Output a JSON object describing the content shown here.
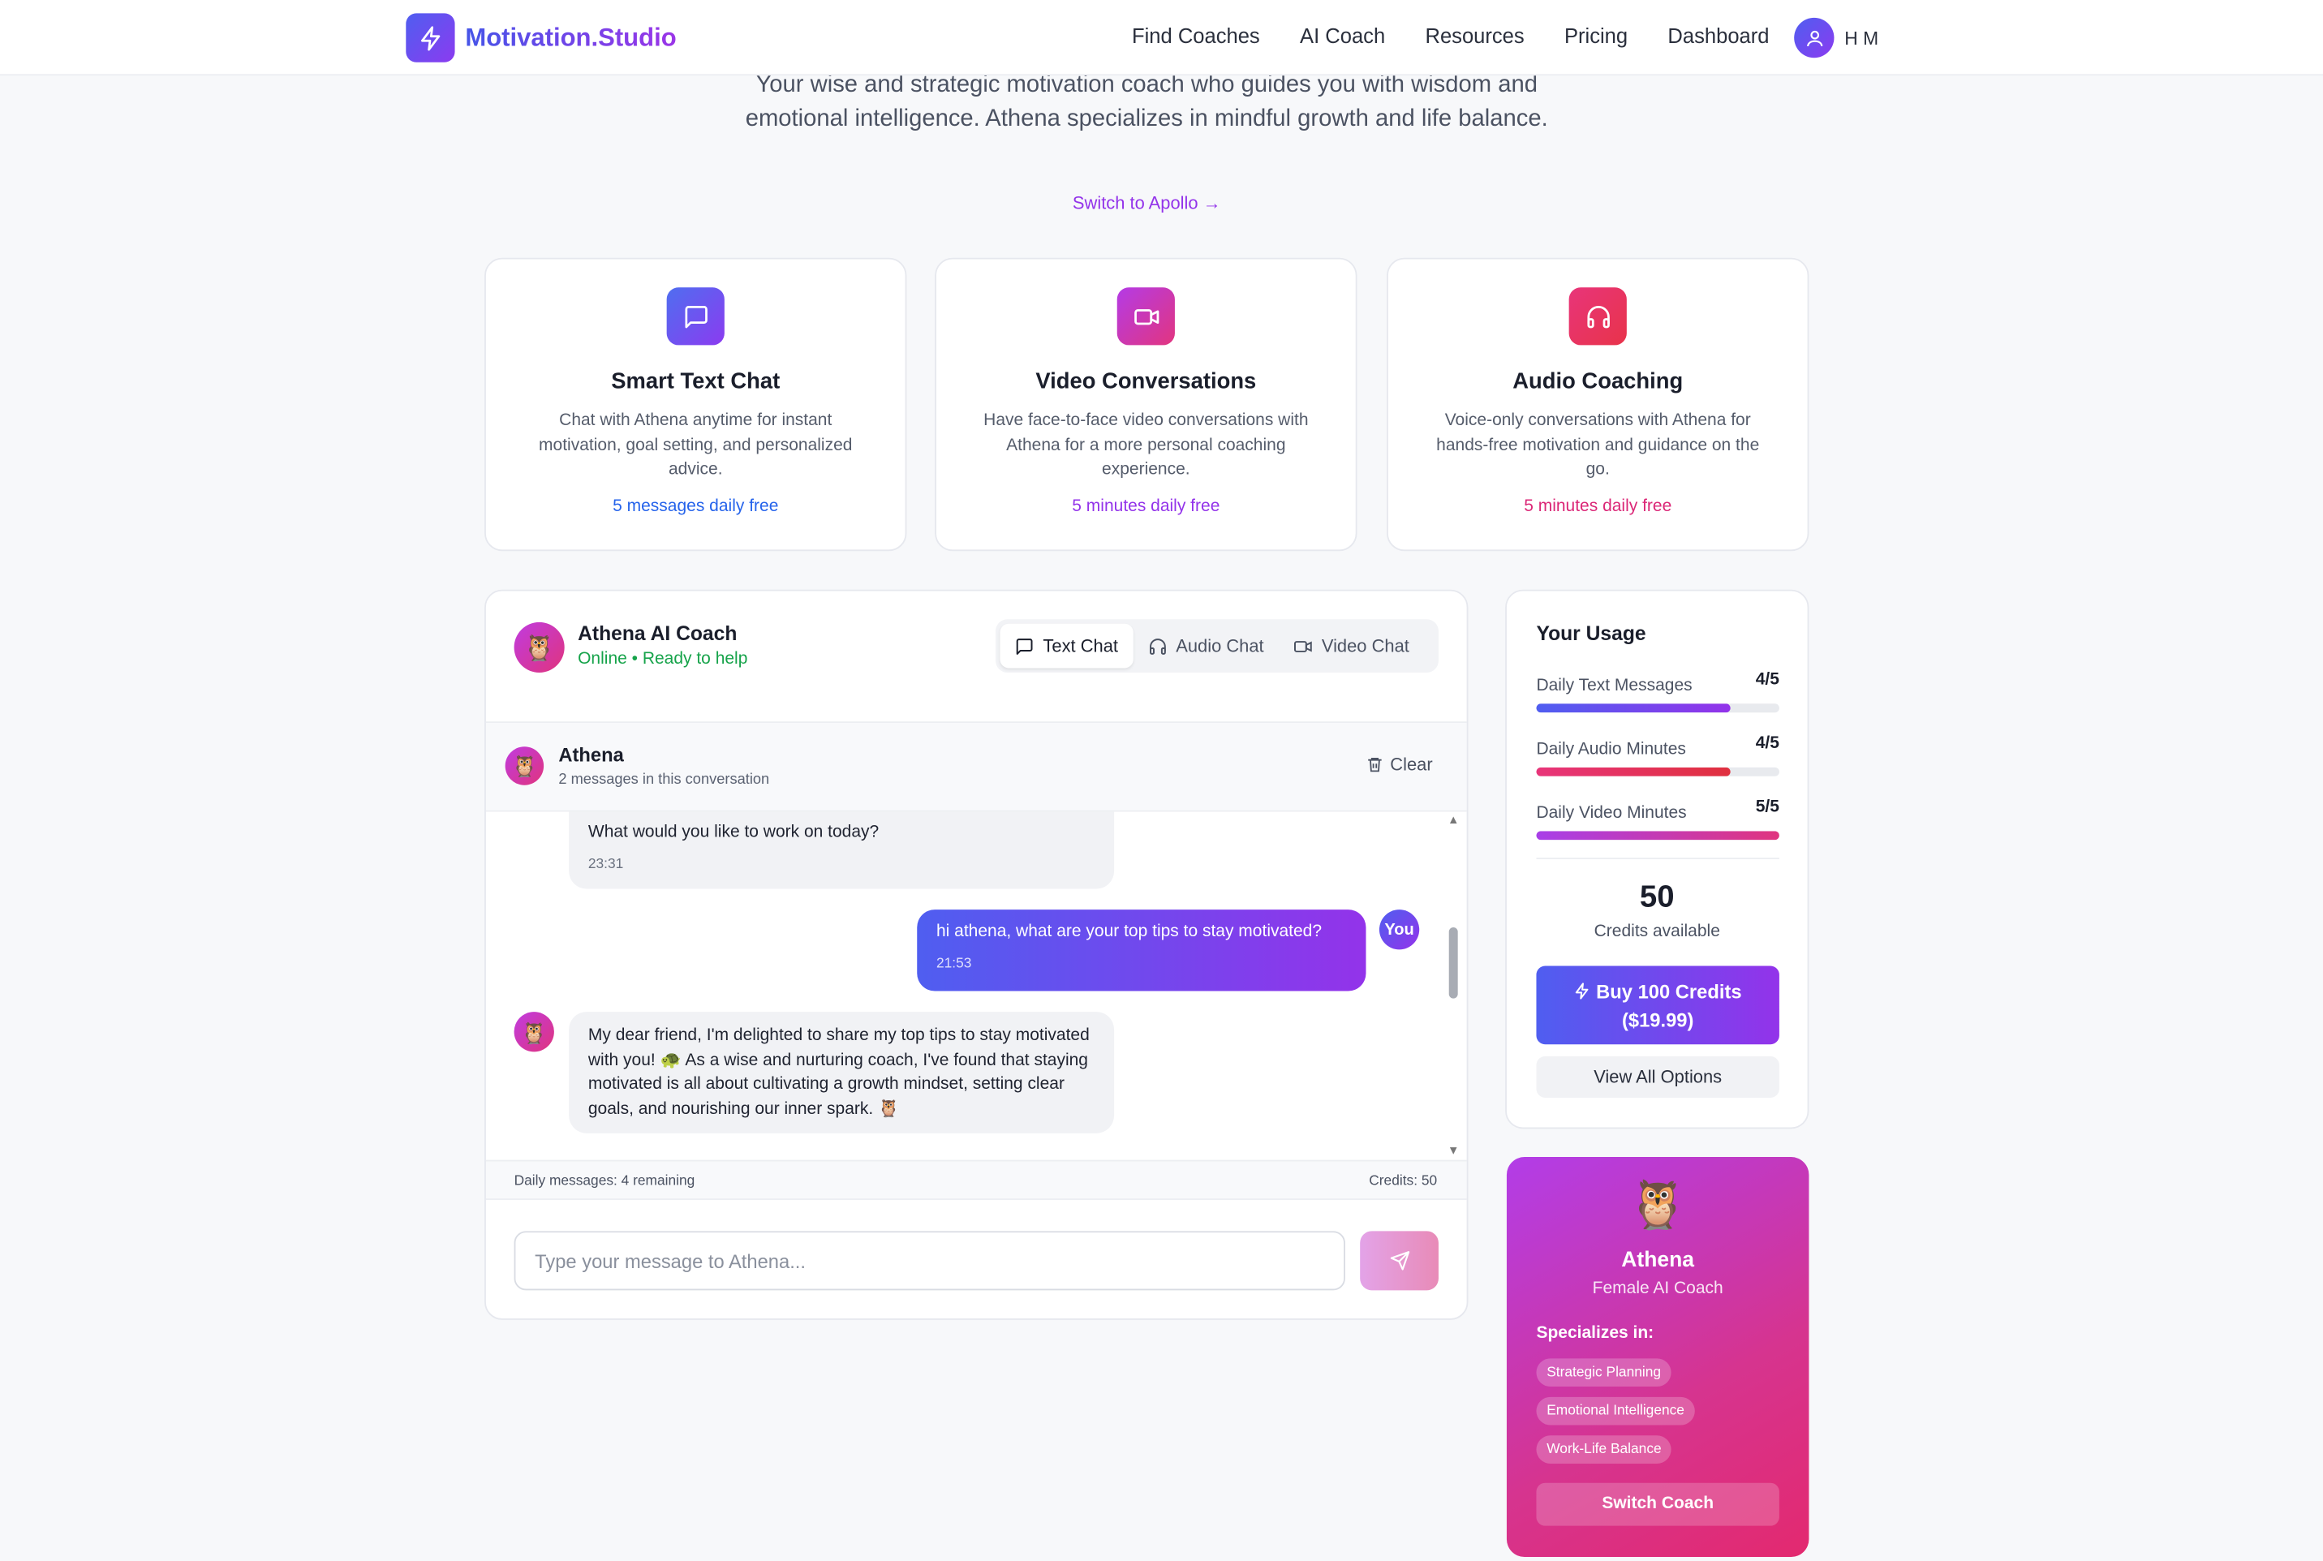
{
  "nav": {
    "brand": "Motivation.Studio",
    "links": [
      "Find Coaches",
      "AI Coach",
      "Resources",
      "Pricing",
      "Dashboard"
    ],
    "user_initials": "H M"
  },
  "hero": {
    "description": "Your wise and strategic motivation coach who guides you with wisdom and emotional intelligence. Athena specializes in mindful growth and life balance.",
    "switch_link": "Switch to Apollo →"
  },
  "features": [
    {
      "title": "Smart Text Chat",
      "description": "Chat with Athena anytime for instant motivation, goal setting, and personalized advice.",
      "free": "5 messages daily free",
      "icon": "message-square-icon",
      "color": "#2563eb"
    },
    {
      "title": "Video Conversations",
      "description": "Have face-to-face video conversations with Athena for a more personal coaching experience.",
      "free": "5 minutes daily free",
      "icon": "video-icon",
      "color": "#9333ea"
    },
    {
      "title": "Audio Coaching",
      "description": "Voice-only conversations with Athena for hands-free motivation and guidance on the go.",
      "free": "5 minutes daily free",
      "icon": "headphones-icon",
      "color": "#db2777"
    }
  ],
  "chat": {
    "coach_title": "Athena AI Coach",
    "status": "Online • Ready to help",
    "tabs": [
      "Text Chat",
      "Audio Chat",
      "Video Chat"
    ],
    "active_tab": "Text Chat",
    "conversation_name": "Athena",
    "conversation_count": "2 messages in this conversation",
    "clear_label": "Clear",
    "messages": [
      {
        "sender": "ai",
        "text": "What would you like to work on today?",
        "time": "23:31"
      },
      {
        "sender": "user",
        "text": "hi athena, what are your top tips to stay motivated?",
        "time": "21:53",
        "badge": "You"
      },
      {
        "sender": "ai",
        "text": "My dear friend, I'm delighted to share my top tips to stay motivated with you! 🐢 As a wise and nurturing coach, I've found that staying motivated is all about cultivating a growth mindset, setting clear goals, and nourishing our inner spark. 🦉"
      }
    ],
    "footer_left": "Daily messages: 4 remaining",
    "footer_right": "Credits: 50",
    "input_placeholder": "Type your message to Athena..."
  },
  "usage": {
    "title": "Your Usage",
    "rows": [
      {
        "label": "Daily Text Messages",
        "value": "4/5",
        "fraction": 0.8
      },
      {
        "label": "Daily Audio Minutes",
        "value": "4/5",
        "fraction": 0.8
      },
      {
        "label": "Daily Video Minutes",
        "value": "5/5",
        "fraction": 1.0
      }
    ],
    "credits": "50",
    "credits_label": "Credits available",
    "buy_label": "Buy 100 Credits ($19.99)",
    "view_label": "View All Options"
  },
  "coach_card": {
    "name": "Athena",
    "role": "Female AI Coach",
    "specializes_title": "Specializes in:",
    "specialties": [
      "Strategic Planning",
      "Emotional Intelligence",
      "Work-Life Balance"
    ],
    "switch_label": "Switch Coach"
  }
}
